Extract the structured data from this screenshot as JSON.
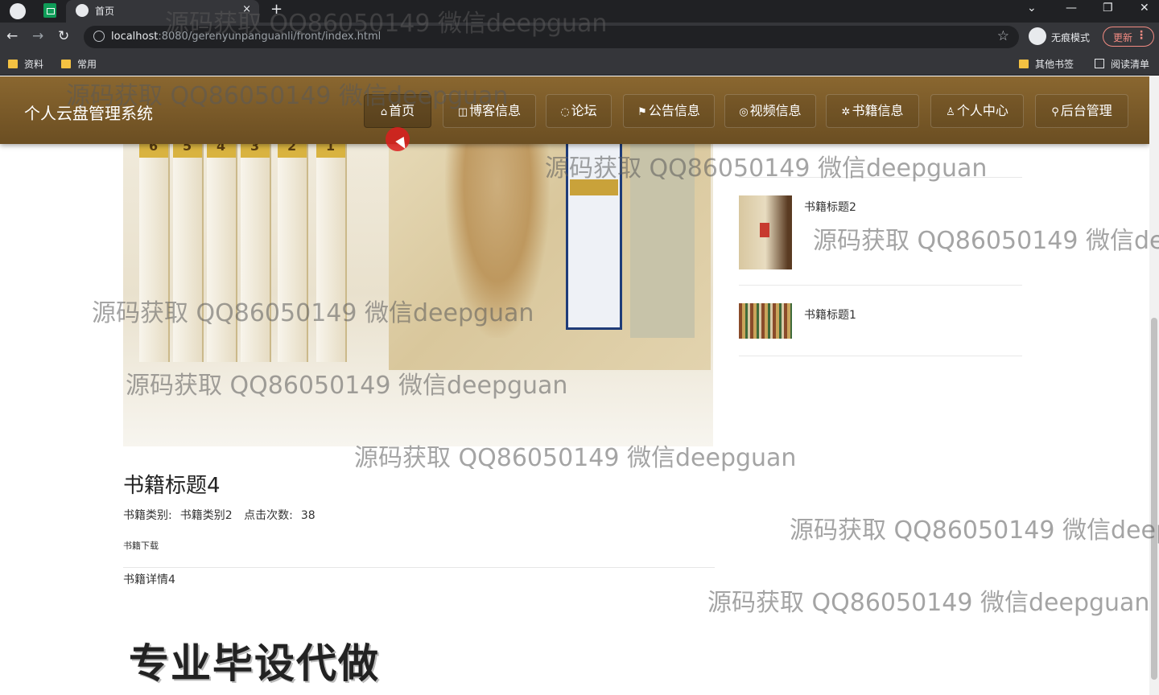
{
  "browser": {
    "tab_title": "首页",
    "tab_close": "×",
    "new_tab": "+",
    "url_host": "localhost",
    "url_rest": ":8080/gerenyunpanguanli/front/index.html",
    "incognito_label": "无痕模式",
    "update_label": "更新",
    "bookmarks": [
      "资料",
      "常用"
    ],
    "bookmarks_right": [
      "其他书签",
      "阅读清单"
    ]
  },
  "header": {
    "brand": "个人云盘管理系统",
    "menu": [
      {
        "icon": "⌂",
        "label": "首页"
      },
      {
        "icon": "◫",
        "label": "博客信息"
      },
      {
        "icon": "◌",
        "label": "论坛"
      },
      {
        "icon": "⚑",
        "label": "公告信息"
      },
      {
        "icon": "◎",
        "label": "视频信息"
      },
      {
        "icon": "✲",
        "label": "书籍信息"
      },
      {
        "icon": "♙",
        "label": "个人中心"
      },
      {
        "icon": "⚲",
        "label": "后台管理"
      }
    ]
  },
  "detail": {
    "title": "书籍标题4",
    "category_label": "书籍类别:",
    "category_value": "书籍类别2",
    "clicks_label": "点击次数:",
    "clicks_value": "38",
    "download": "书籍下载",
    "content": "书籍详情4",
    "spine_numbers": [
      "6",
      "5",
      "4",
      "3",
      "2",
      "1"
    ]
  },
  "sidebar": {
    "items": [
      {
        "title": "书籍标题2"
      },
      {
        "title": "书籍标题1"
      }
    ]
  },
  "promo": "专业毕设代做",
  "watermark": "源码获取 QQ86050149 微信deepguan",
  "colors": {
    "header": "#7a5a28",
    "chrome": "#35363a",
    "accent": "#f28b82"
  }
}
